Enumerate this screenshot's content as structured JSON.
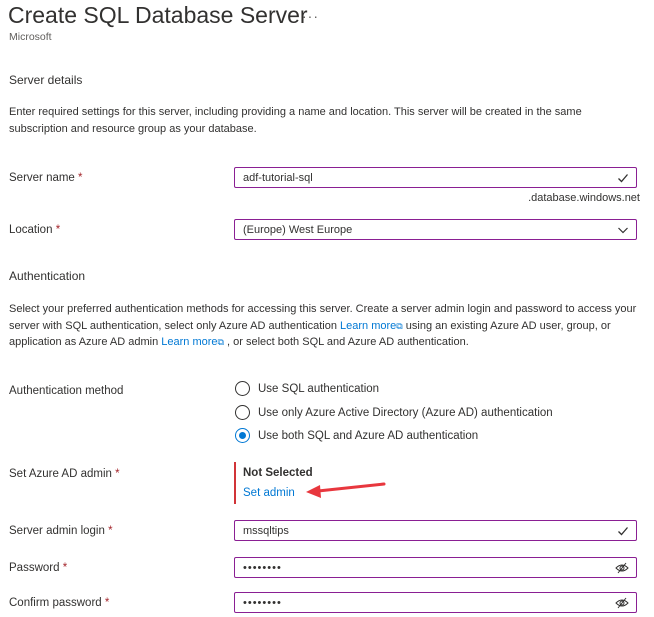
{
  "header": {
    "title": "Create SQL Database Server",
    "more": "···",
    "publisher": "Microsoft"
  },
  "server_details": {
    "heading": "Server details",
    "description": "Enter required settings for this server, including providing a name and location. This server will be created in the same subscription and resource group as your database.",
    "server_name": {
      "label": "Server name",
      "required": "*",
      "value": "adf-tutorial-sql",
      "suffix": ".database.windows.net"
    },
    "location": {
      "label": "Location",
      "required": "*",
      "value": "(Europe) West Europe"
    }
  },
  "authentication": {
    "heading": "Authentication",
    "desc_part1": "Select your preferred authentication methods for accessing this server. Create a server admin login and password to access your server with SQL authentication, select only Azure AD authentication ",
    "learn_more_1": "Learn more",
    "desc_part2": " using an existing Azure AD user, group, or application as Azure AD admin ",
    "learn_more_2": "Learn more",
    "desc_part3": " , or select both SQL and Azure AD authentication.",
    "method_label": "Authentication method",
    "options": [
      {
        "label": "Use SQL authentication",
        "selected": false
      },
      {
        "label": "Use only Azure Active Directory (Azure AD) authentication",
        "selected": false
      },
      {
        "label": "Use both SQL and Azure AD authentication",
        "selected": true
      }
    ],
    "azure_ad_admin": {
      "label": "Set Azure AD admin",
      "required": "*",
      "status": "Not Selected",
      "link": "Set admin"
    },
    "admin_login": {
      "label": "Server admin login",
      "required": "*",
      "value": "mssqltips"
    },
    "password": {
      "label": "Password",
      "required": "*",
      "value": "••••••••"
    },
    "confirm_password": {
      "label": "Confirm password",
      "required": "*",
      "value": "••••••••"
    }
  },
  "colors": {
    "input_border": "#8a1f93",
    "link": "#0078d4",
    "required": "#a4262c",
    "annotation_arrow": "#e8373e"
  }
}
